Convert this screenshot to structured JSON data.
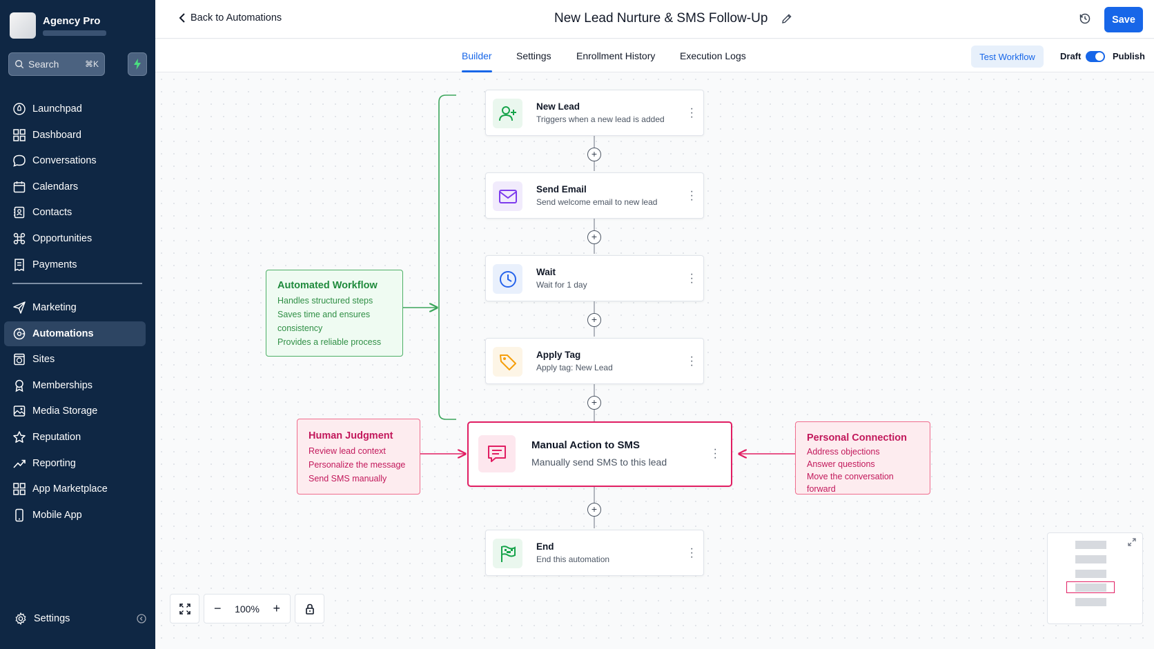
{
  "account": {
    "name": "Agency Pro"
  },
  "search": {
    "placeholder": "Search",
    "shortcut": "⌘K"
  },
  "sidebar": {
    "items_top": [
      {
        "label": "Launchpad",
        "icon": "rocket-icon"
      },
      {
        "label": "Dashboard",
        "icon": "grid-icon"
      },
      {
        "label": "Conversations",
        "icon": "chat-icon"
      },
      {
        "label": "Calendars",
        "icon": "calendar-icon"
      },
      {
        "label": "Contacts",
        "icon": "contacts-icon"
      },
      {
        "label": "Opportunities",
        "icon": "pipeline-icon"
      },
      {
        "label": "Payments",
        "icon": "receipt-icon"
      }
    ],
    "items_bottom": [
      {
        "label": "Marketing",
        "icon": "send-icon"
      },
      {
        "label": "Automations",
        "icon": "automation-icon",
        "active": true
      },
      {
        "label": "Sites",
        "icon": "globe-icon"
      },
      {
        "label": "Memberships",
        "icon": "badge-icon"
      },
      {
        "label": "Media Storage",
        "icon": "image-icon"
      },
      {
        "label": "Reputation",
        "icon": "star-icon"
      },
      {
        "label": "Reporting",
        "icon": "trend-icon"
      },
      {
        "label": "App Marketplace",
        "icon": "apps-icon"
      },
      {
        "label": "Mobile App",
        "icon": "phone-icon"
      }
    ],
    "settings_label": "Settings"
  },
  "topbar": {
    "back_label": "Back to Automations",
    "title": "New Lead Nurture & SMS Follow-Up",
    "save_label": "Save"
  },
  "tabs": {
    "items": [
      "Builder",
      "Settings",
      "Enrollment History",
      "Execution Logs"
    ],
    "active": "Builder",
    "test_label": "Test Workflow",
    "draft_label": "Draft",
    "publish_label": "Publish",
    "published": true
  },
  "workflow": {
    "steps": [
      {
        "title": "New Lead",
        "desc": "Triggers when a new lead is added",
        "icon": "user-plus-icon",
        "color": "#16a34a"
      },
      {
        "title": "Send Email",
        "desc": "Send welcome email to new lead",
        "icon": "mail-icon",
        "color": "#7c3aed"
      },
      {
        "title": "Wait",
        "desc": "Wait for 1 day",
        "icon": "clock-icon",
        "color": "#2563eb"
      },
      {
        "title": "Apply Tag",
        "desc": "Apply tag: New Lead",
        "icon": "tag-icon",
        "color": "#f59e0b"
      },
      {
        "title": "Manual Action to SMS",
        "desc": "Manually send SMS to this lead",
        "icon": "sms-icon",
        "color": "#e11d62"
      },
      {
        "title": "End",
        "desc": "End this automation",
        "icon": "flag-icon",
        "color": "#16a34a"
      }
    ]
  },
  "notes": {
    "automated": {
      "title": "Automated Workflow",
      "lines": [
        "Handles structured steps",
        "Saves time and ensures",
        "consistency",
        "Provides a reliable process"
      ]
    },
    "human": {
      "title": "Human Judgment",
      "lines": [
        "Review lead context",
        "Personalize the message",
        "Send SMS manually"
      ]
    },
    "personal": {
      "title": "Personal Connection",
      "lines": [
        "Address objections",
        "Answer questions",
        "Move the conversation forward"
      ]
    }
  },
  "zoom": {
    "level": "100%"
  },
  "colors": {
    "accent": "#1766e8",
    "sidebar": "#0f2744",
    "manual": "#e11d62",
    "automated": "#16a34a"
  }
}
